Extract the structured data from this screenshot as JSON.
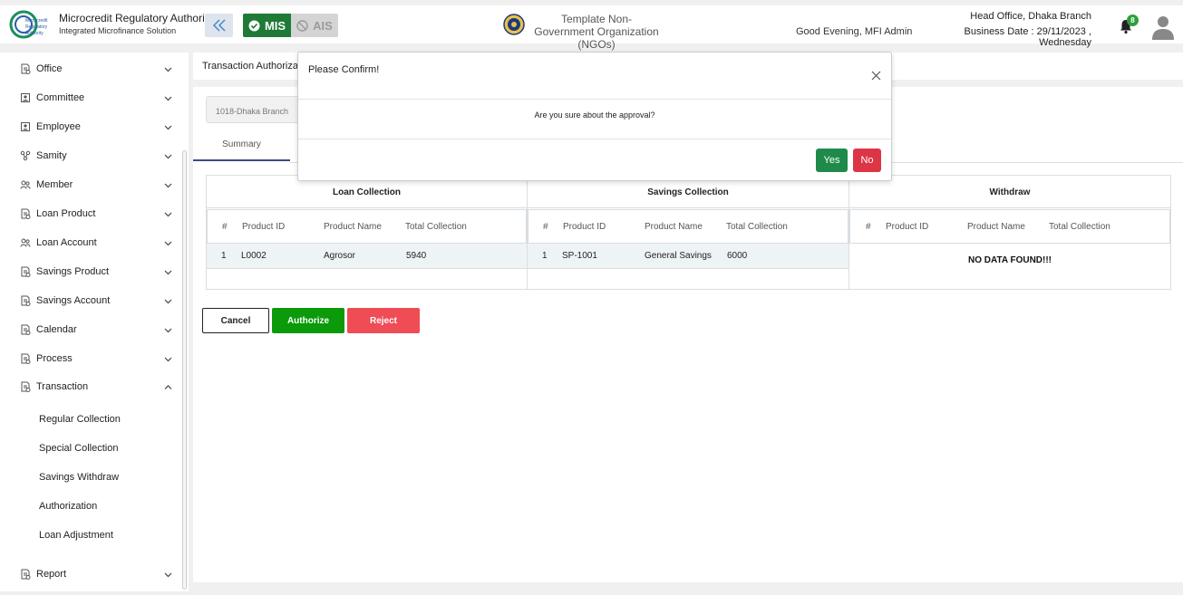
{
  "header": {
    "brand_title": "Microcredit Regulatory Authority",
    "brand_subtitle": "Integrated Microfinance Solution",
    "logo_text": "Microcredit Regulatory Authority",
    "mode_mis": "MIS",
    "mode_ais": "AIS",
    "org_name": "Template Non-Government Organization (NGOs)",
    "greeting": "Good Evening, MFI Admin",
    "office": "Head Office, Dhaka Branch",
    "business_date": "Business Date : 29/11/2023 , Wednesday",
    "notification_count": "8",
    "colors": {
      "mis": "#1f7a36",
      "badge": "#2e9e3d"
    }
  },
  "sidebar": {
    "items": [
      {
        "label": "Office",
        "icon": "document-icon"
      },
      {
        "label": "Committee",
        "icon": "group-icon"
      },
      {
        "label": "Employee",
        "icon": "person-icon"
      },
      {
        "label": "Samity",
        "icon": "network-icon"
      },
      {
        "label": "Member",
        "icon": "members-icon"
      },
      {
        "label": "Loan Product",
        "icon": "document-icon"
      },
      {
        "label": "Loan Account",
        "icon": "members-icon"
      },
      {
        "label": "Savings Product",
        "icon": "document-icon"
      },
      {
        "label": "Savings Account",
        "icon": "document-icon"
      },
      {
        "label": "Calendar",
        "icon": "document-icon"
      },
      {
        "label": "Process",
        "icon": "document-icon"
      },
      {
        "label": "Transaction",
        "icon": "document-icon"
      }
    ],
    "transaction_subitems": [
      "Regular Collection",
      "Special Collection",
      "Savings Withdraw",
      "Authorization",
      "Loan Adjustment"
    ],
    "report": {
      "label": "Report",
      "icon": "document-icon"
    }
  },
  "main": {
    "breadcrumb": "Transaction Authorization",
    "branch_select": "1018-Dhaka Branch",
    "tab_summary": "Summary",
    "sections": {
      "loan": {
        "title": "Loan Collection",
        "headers": [
          "#",
          "Product ID",
          "Product Name",
          "Total Collection"
        ],
        "rows": [
          [
            "1",
            "L0002",
            "Agrosor",
            "5940"
          ]
        ]
      },
      "savings": {
        "title": "Savings Collection",
        "headers": [
          "#",
          "Product ID",
          "Product Name",
          "Total Collection"
        ],
        "rows": [
          [
            "1",
            "SP-1001",
            "General Savings",
            "6000"
          ]
        ]
      },
      "withdraw": {
        "title": "Withdraw",
        "headers": [
          "#",
          "Product ID",
          "Product Name",
          "Total Collection"
        ],
        "empty_text": "NO DATA FOUND!!!"
      }
    },
    "buttons": {
      "cancel": "Cancel",
      "authorize": "Authorize",
      "reject": "Reject"
    }
  },
  "modal": {
    "title": "Please Confirm!",
    "body": "Are you sure about the approval?",
    "yes": "Yes",
    "no": "No"
  }
}
